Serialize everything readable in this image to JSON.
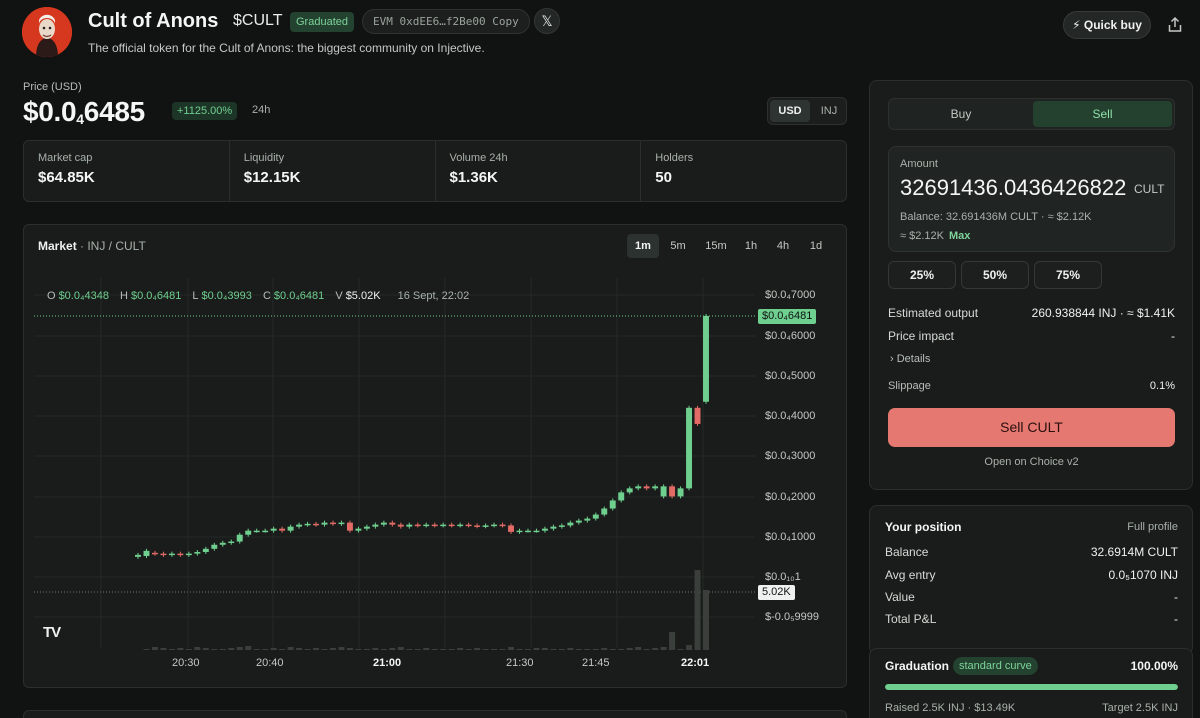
{
  "token": {
    "name": "Cult of Anons",
    "ticker": "$CULT",
    "status_badge": "Graduated",
    "address": "EVM  0xdEE6…f2Be00  Copy",
    "x_label": "𝕏",
    "tagline": "The official token for the Cult of Anons: the biggest community on Injective."
  },
  "header": {
    "quick_buy": "⚡ Quick buy",
    "share_icon": "share-icon"
  },
  "price": {
    "label": "Price (USD)",
    "prefix": "$0.0",
    "sub": "4",
    "digits": "6485",
    "change": "+1125.00%",
    "period": "24h",
    "unit_usd": "USD",
    "unit_inj": "INJ"
  },
  "stats": [
    {
      "label": "Market cap",
      "value": "$64.85K"
    },
    {
      "label": "Liquidity",
      "value": "$12.15K"
    },
    {
      "label": "Volume 24h",
      "value": "$1.36K"
    },
    {
      "label": "Holders",
      "value": "50"
    }
  ],
  "chart": {
    "title": "Market",
    "pair": " · INJ / CULT",
    "timeframes": [
      "1m",
      "5m",
      "15m",
      "1h",
      "4h",
      "1d"
    ],
    "active_timeframe": "1m",
    "ohlc": {
      "o_key": "O",
      "o_val": "$0.0₄4348",
      "h_key": "H",
      "h_val": "$0.0₄6481",
      "l_key": "L",
      "l_val": "$0.0₄3993",
      "c_key": "C",
      "c_val": "$0.0₄6481",
      "v_key": "V",
      "v_val": "$5.02K",
      "time": "16 Sept, 22:02"
    },
    "last_price_tag": "$0.0₄6481",
    "volume_tag": "5.02K",
    "tv_logo": "TV"
  },
  "chart_data": {
    "type": "candlestick",
    "y_ticks": [
      "$0.0₄7000",
      "$0.0₄6000",
      "$0.0₄5000",
      "$0.0₄4000",
      "$0.0₄3000",
      "$0.0₄2000",
      "$0.0₄1000",
      "$0.0₁₀1",
      "$-0.0₅9999"
    ],
    "y_tick_values": [
      7e-05,
      6e-05,
      5e-05,
      4e-05,
      3e-05,
      2e-05,
      1e-05,
      0,
      -9.999e-06
    ],
    "ylim": [
      -9.999e-06,
      7e-05
    ],
    "x_ticks": [
      "20:30",
      "20:40",
      "21:00",
      "21:30",
      "21:45",
      "22:01"
    ],
    "x_ticks_bold": [
      "21:00",
      "22:01"
    ],
    "price_unit": "USD, ×1e-5",
    "candles": [
      [
        0.5,
        0.55
      ],
      [
        0.52,
        0.65
      ],
      [
        0.6,
        0.58
      ],
      [
        0.58,
        0.55
      ],
      [
        0.55,
        0.58
      ],
      [
        0.58,
        0.55
      ],
      [
        0.55,
        0.58
      ],
      [
        0.58,
        0.62
      ],
      [
        0.62,
        0.7
      ],
      [
        0.7,
        0.8
      ],
      [
        0.8,
        0.85
      ],
      [
        0.85,
        0.88
      ],
      [
        0.88,
        1.05
      ],
      [
        1.05,
        1.15
      ],
      [
        1.15,
        1.15
      ],
      [
        1.15,
        1.15
      ],
      [
        1.15,
        1.2
      ],
      [
        1.2,
        1.15
      ],
      [
        1.15,
        1.25
      ],
      [
        1.25,
        1.3
      ],
      [
        1.3,
        1.32
      ],
      [
        1.32,
        1.3
      ],
      [
        1.3,
        1.35
      ],
      [
        1.35,
        1.32
      ],
      [
        1.32,
        1.35
      ],
      [
        1.35,
        1.15
      ],
      [
        1.15,
        1.2
      ],
      [
        1.2,
        1.25
      ],
      [
        1.25,
        1.3
      ],
      [
        1.3,
        1.35
      ],
      [
        1.35,
        1.3
      ],
      [
        1.3,
        1.25
      ],
      [
        1.25,
        1.3
      ],
      [
        1.3,
        1.28
      ],
      [
        1.28,
        1.3
      ],
      [
        1.3,
        1.28
      ],
      [
        1.28,
        1.3
      ],
      [
        1.3,
        1.28
      ],
      [
        1.28,
        1.3
      ],
      [
        1.3,
        1.28
      ],
      [
        1.28,
        1.26
      ],
      [
        1.26,
        1.28
      ],
      [
        1.28,
        1.3
      ],
      [
        1.3,
        1.28
      ],
      [
        1.28,
        1.12
      ],
      [
        1.12,
        1.15
      ],
      [
        1.15,
        1.15
      ],
      [
        1.15,
        1.15
      ],
      [
        1.15,
        1.2
      ],
      [
        1.2,
        1.25
      ],
      [
        1.25,
        1.28
      ],
      [
        1.28,
        1.35
      ],
      [
        1.35,
        1.4
      ],
      [
        1.4,
        1.45
      ],
      [
        1.45,
        1.55
      ],
      [
        1.55,
        1.7
      ],
      [
        1.7,
        1.9
      ],
      [
        1.9,
        2.1
      ],
      [
        2.1,
        2.2
      ],
      [
        2.2,
        2.25
      ],
      [
        2.25,
        2.2
      ],
      [
        2.2,
        2.25
      ],
      [
        2.0,
        2.25
      ],
      [
        2.25,
        2.0
      ],
      [
        2.0,
        2.2
      ],
      [
        2.2,
        4.2
      ],
      [
        4.2,
        3.8
      ],
      [
        4.35,
        6.48
      ]
    ],
    "volumes": [
      0,
      1,
      3,
      2,
      1,
      2,
      1,
      3,
      2,
      1,
      1,
      2,
      3,
      4,
      1,
      1,
      2,
      1,
      3,
      2,
      1,
      2,
      1,
      2,
      3,
      2,
      1,
      1,
      2,
      1,
      2,
      3,
      1,
      1,
      2,
      1,
      1,
      1,
      2,
      1,
      2,
      1,
      1,
      1,
      3,
      1,
      1,
      2,
      2,
      1,
      1,
      2,
      1,
      1,
      1,
      2,
      1,
      1,
      2,
      3,
      1,
      2,
      3,
      18,
      1,
      5,
      80,
      60
    ]
  },
  "trade": {
    "buy": "Buy",
    "sell": "Sell",
    "amount_label": "Amount",
    "amount_value": "32691436.0436426822",
    "amount_unit": "CULT",
    "balance_line": "Balance: 32.691436M CULT · ≈ $2.12K",
    "usd_approx": "≈ $2.12K",
    "max": "Max",
    "pct_buttons": [
      "25%",
      "50%",
      "75%"
    ],
    "est_label": "Estimated output",
    "est_value": "260.938844 INJ · ≈ $1.41K",
    "impact_label": "Price impact",
    "impact_value": "-",
    "details": "›  Details",
    "slippage_label": "Slippage",
    "slippage_value": "0.1%",
    "sell_button": "Sell CULT",
    "open_link": "Open on Choice v2"
  },
  "position": {
    "title": "Your position",
    "link": "Full profile",
    "rows": [
      {
        "label": "Balance",
        "value": "32.6914M CULT"
      },
      {
        "label": "Avg entry",
        "value": "0.0₅1070 INJ"
      },
      {
        "label": "Value",
        "value": "-"
      },
      {
        "label": "Total P&L",
        "value": "-"
      }
    ]
  },
  "graduation": {
    "title": "Graduation",
    "badge": "standard curve",
    "percent": "100.00%",
    "progress": 1.0,
    "raised": "Raised 2.5K INJ · $13.49K",
    "target": "Target 2.5K INJ"
  }
}
